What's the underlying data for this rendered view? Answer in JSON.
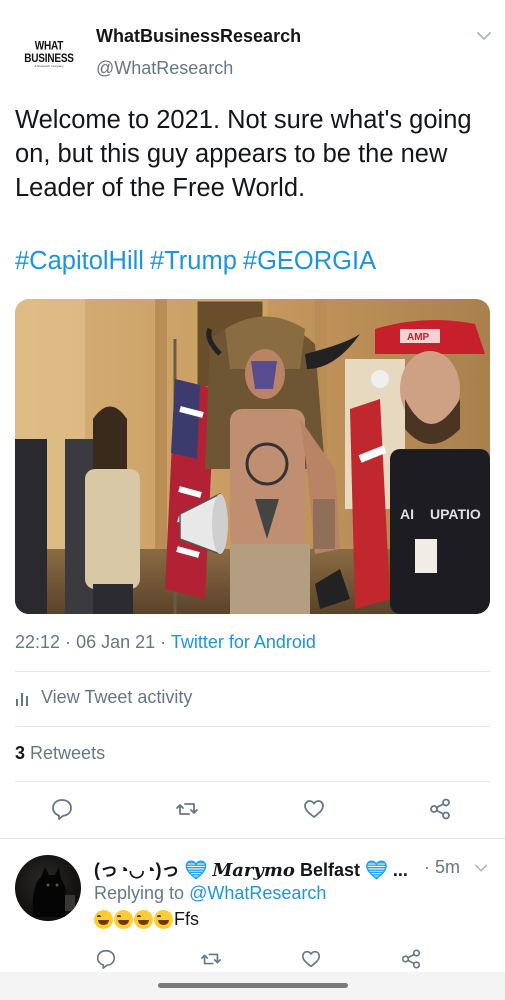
{
  "tweet": {
    "display_name": "WhatBusinessResearch",
    "handle": "@WhatResearch",
    "avatar_brand": "WHAT BUSINESS",
    "avatar_subtext": "A Research Company",
    "text": "Welcome to 2021. Not sure what's going on, but this guy appears to be the new Leader of the Free World.",
    "hashtags": [
      "#CapitolHill",
      "#Trump",
      "#GEORGIA"
    ],
    "time": "22:12",
    "date": "06 Jan 21",
    "source": "Twitter for Android",
    "activity_label": "View Tweet activity",
    "retweet_count": "3",
    "retweet_label": "Retweets",
    "media_alt_words": [
      "AMP",
      "AI",
      "UPATIO"
    ]
  },
  "reply": {
    "name_prefix": "(っ◔◡◔)っ",
    "name_script": "Marymo",
    "name_suffix": "Belfast",
    "name_ellipsis": "...",
    "time": "5m",
    "replying_prefix": "Replying to",
    "replying_handle": "@WhatResearch",
    "text": "Ffs",
    "emoji_count": 4
  },
  "icons": [
    "chevron-down-icon",
    "reply-icon",
    "retweet-icon",
    "like-icon",
    "share-icon",
    "activity-bars-icon",
    "verified-heart-icon"
  ],
  "colors": {
    "link": "#1b95e0",
    "secondary_text": "#657786",
    "primary_text": "#14171a",
    "divider": "#e1e8ed"
  }
}
